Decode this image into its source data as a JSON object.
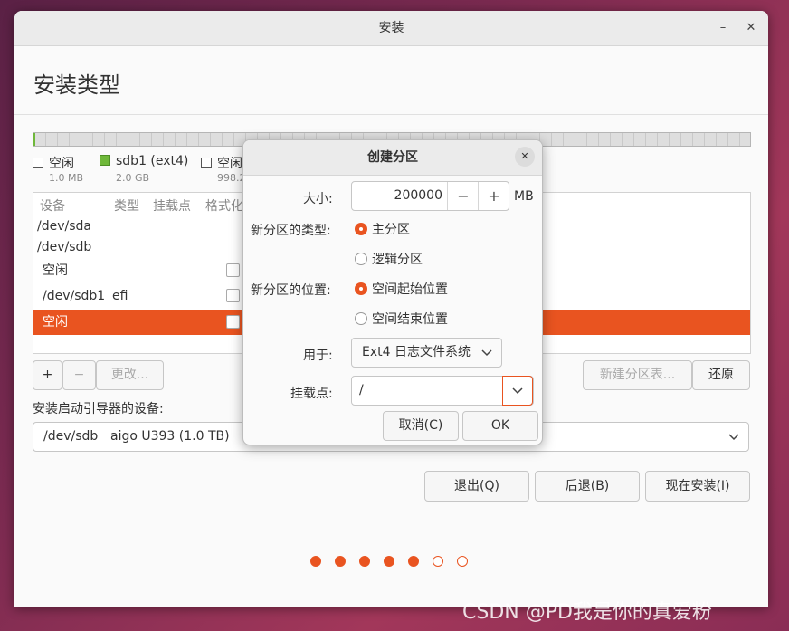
{
  "window": {
    "title": "安装",
    "minimize": "–",
    "close": "✕"
  },
  "page_title": "安装类型",
  "legend": [
    {
      "label": "空闲",
      "size": "1.0 MB",
      "color": "#ffffff"
    },
    {
      "label": "sdb1 (ext4)",
      "size": "2.0 GB",
      "color": "#6fb83a"
    },
    {
      "label": "空闲",
      "size": "998.2",
      "color": "#ffffff"
    }
  ],
  "table": {
    "headers": [
      "设备",
      "类型",
      "挂载点",
      "格式化"
    ],
    "rows": [
      {
        "device": "/dev/sda",
        "type": ""
      },
      {
        "device": "/dev/sdb",
        "type": ""
      },
      {
        "device": "空闲",
        "type": ""
      },
      {
        "device": "/dev/sdb1",
        "type": "efi"
      },
      {
        "device": "空闲",
        "type": ""
      }
    ]
  },
  "actions": {
    "add": "+",
    "remove": "−",
    "change": "更改...",
    "new_table": "新建分区表...",
    "revert": "还原"
  },
  "bootloader": {
    "label": "安装启动引导器的设备:",
    "device": "/dev/sdb",
    "desc": "aigo U393 (1.0 TB)"
  },
  "nav": {
    "quit": "退出(Q)",
    "back": "后退(B)",
    "install": "现在安装(I)"
  },
  "progress": {
    "total": 7,
    "done": 5
  },
  "dialog": {
    "title": "创建分区",
    "close": "✕",
    "size_label": "大小:",
    "size_value": "200000",
    "size_unit": "MB",
    "minus": "−",
    "plus": "+",
    "type_label": "新分区的类型:",
    "type_primary": "主分区",
    "type_logical": "逻辑分区",
    "pos_label": "新分区的位置:",
    "pos_begin": "空间起始位置",
    "pos_end": "空间结束位置",
    "use_label": "用于:",
    "use_value": "Ext4 日志文件系统",
    "mount_label": "挂载点:",
    "mount_value": "/",
    "cancel": "取消(C)",
    "ok": "OK"
  },
  "watermark": "CSDN @PD我是你的真爱粉",
  "colors": {
    "accent": "#e95420",
    "ext4": "#6fb83a"
  }
}
